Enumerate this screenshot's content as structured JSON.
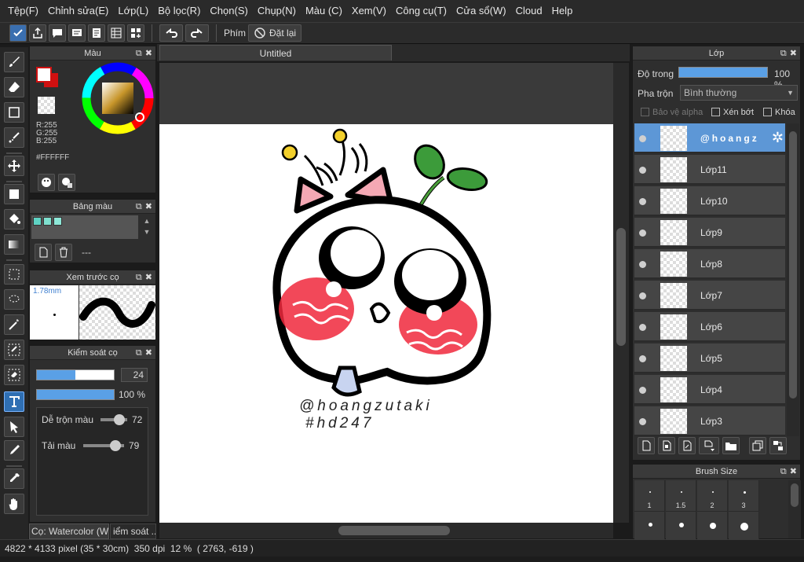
{
  "menu": [
    "Tệp(F)",
    "Chỉnh sửa(E)",
    "Lớp(L)",
    "Bộ lọc(R)",
    "Chọn(S)",
    "Chụp(N)",
    "Màu (C)",
    "Xem(V)",
    "Công cụ(T)",
    "Cửa sổ(W)",
    "Cloud",
    "Help"
  ],
  "toolbar": {
    "hotkey_label": "Phím",
    "reset_label": "Đặt lại"
  },
  "color_panel": {
    "title": "Màu",
    "r": "R:255",
    "g": "G:255",
    "b": "B:255",
    "hex": "#FFFFFF",
    "accent": "#d01010"
  },
  "palette_panel": {
    "title": "Bảng màu",
    "name": "---",
    "swatches": [
      "#5fd3c4",
      "#7fe0cf",
      "#8ee8d8"
    ]
  },
  "brush_preview": {
    "title": "Xem trước cọ",
    "size": "1.78mm"
  },
  "brush_control": {
    "title": "Kiểm soát cọ",
    "size_value": "24",
    "size_frac": 0.5,
    "opacity_value": "100 %",
    "opacity_frac": 1.0,
    "blend_label": "Dễ trộn màu",
    "blend_value": "72",
    "blend_frac": 0.72,
    "load_label": "Tải màu",
    "load_value": "79",
    "load_frac": 0.79
  },
  "bottom_tabs": [
    "Cọ: Watercolor (W...",
    "iểm soát ..."
  ],
  "document": {
    "tab": "Untitled",
    "signature": "@hoangzutaki",
    "hashtag": "#hd247"
  },
  "layer_panel": {
    "title": "Lớp",
    "opacity_label": "Độ trong",
    "opacity_value": "100 %",
    "opacity_frac": 1.0,
    "blend_label": "Pha trộn",
    "blend_value": "Bình thường",
    "protect_alpha": "Bảo vệ alpha",
    "clipping": "Xén bớt",
    "lock": "Khóa",
    "layers": [
      {
        "name": "@hoangz",
        "selected": true
      },
      {
        "name": "Lớp11"
      },
      {
        "name": "Lớp10"
      },
      {
        "name": "Lớp9"
      },
      {
        "name": "Lớp8"
      },
      {
        "name": "Lớp7"
      },
      {
        "name": "Lớp6"
      },
      {
        "name": "Lớp5"
      },
      {
        "name": "Lớp4"
      },
      {
        "name": "Lớp3"
      }
    ]
  },
  "brush_size_panel": {
    "title": "Brush Size",
    "sizes": [
      "1",
      "1.5",
      "2",
      "3"
    ]
  },
  "status": {
    "dimensions": "4822 * 4133 pixel",
    "physical": "(35 * 30cm)",
    "dpi": "350 dpi",
    "zoom": "12 %",
    "coords": "( 2763, -619 )"
  }
}
